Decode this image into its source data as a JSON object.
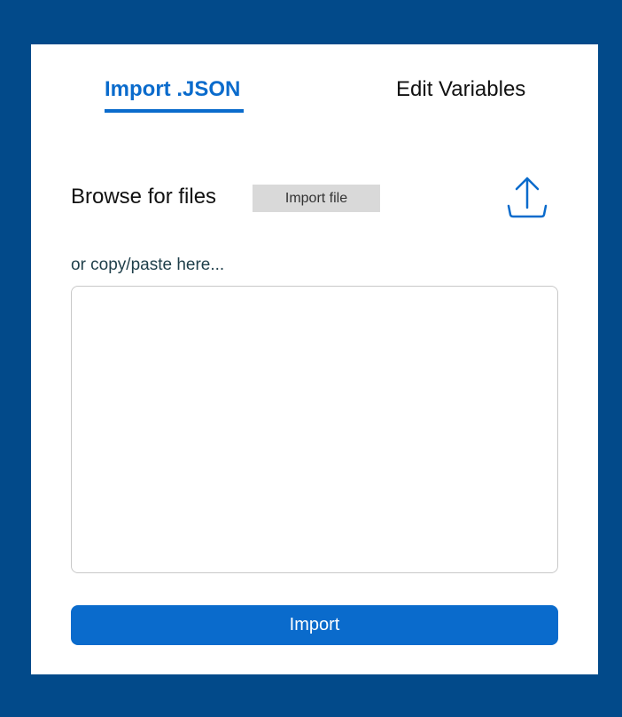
{
  "tabs": [
    {
      "label": "Import .JSON",
      "active": true
    },
    {
      "label": "Edit Variables",
      "active": false
    }
  ],
  "browse": {
    "label": "Browse for files",
    "button_label": "Import file",
    "icon": "upload-icon"
  },
  "paste": {
    "label": "or copy/paste here...",
    "value": "",
    "placeholder": ""
  },
  "import_button": {
    "label": "Import"
  },
  "colors": {
    "background": "#024a8a",
    "panel": "#ffffff",
    "accent": "#0a6bcc",
    "secondary_button": "#d9d9d9",
    "textarea_border": "#c8c8c8"
  }
}
